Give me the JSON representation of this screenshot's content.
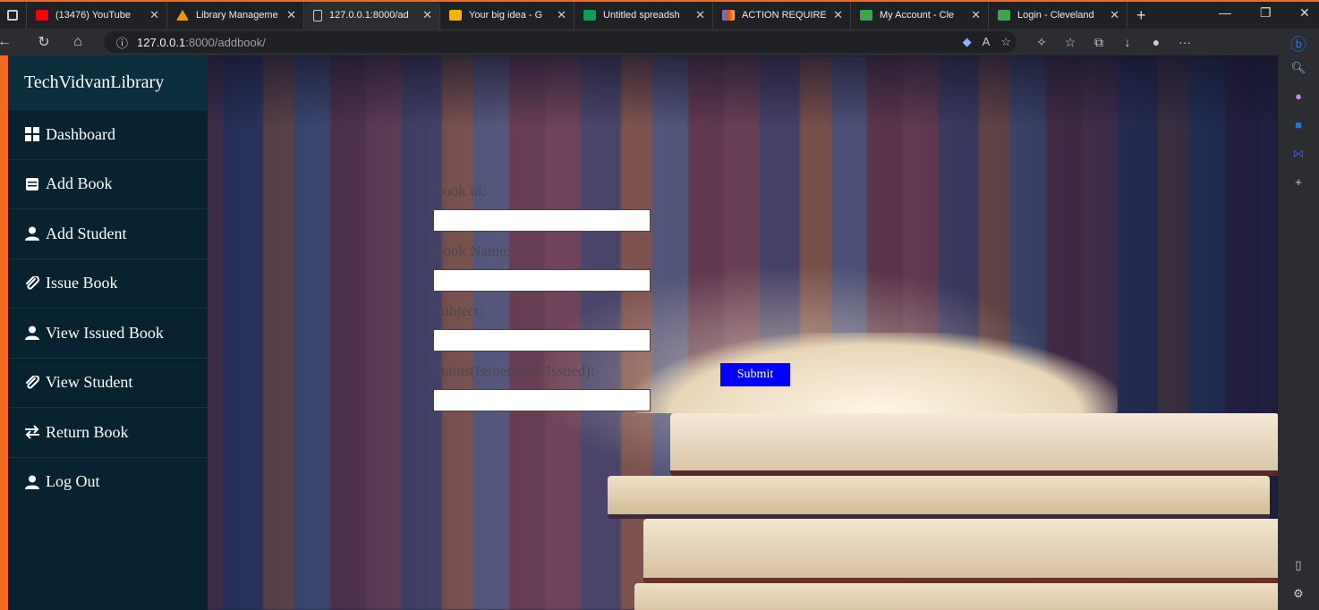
{
  "browser": {
    "tabs": [
      {
        "title": "(13476) YouTube",
        "color": "#ff0000"
      },
      {
        "title": "Library Manageme",
        "color": "#f29900"
      },
      {
        "title": "127.0.0.1:8000/ad",
        "color": "#cccccc",
        "active": true
      },
      {
        "title": "Your big idea - G",
        "color": "#f4b400"
      },
      {
        "title": "Untitled spreadsh",
        "color": "#0f9d58"
      },
      {
        "title": "ACTION REQUIRE",
        "color": "#ea4335"
      },
      {
        "title": "My Account - Cle",
        "color": "#3fa34d"
      },
      {
        "title": "Login - Cleveland",
        "color": "#3fa34d"
      }
    ],
    "url_host": "127.0.0.1",
    "url_path": ":8000/addbook/"
  },
  "sidebar": {
    "brand": "TechVidvanLibrary",
    "items": [
      {
        "label": "Dashboard",
        "icon": "grid-icon"
      },
      {
        "label": "Add Book",
        "icon": "book-icon"
      },
      {
        "label": "Add Student",
        "icon": "user-icon"
      },
      {
        "label": "Issue Book",
        "icon": "paperclip-icon"
      },
      {
        "label": "View Issued Book",
        "icon": "user-icon"
      },
      {
        "label": "View Student",
        "icon": "paperclip-icon"
      },
      {
        "label": "Return Book",
        "icon": "exchange-icon"
      },
      {
        "label": "Log Out",
        "icon": "user-icon"
      }
    ]
  },
  "form": {
    "book_id_label": "Book id:",
    "book_id_value": "",
    "book_name_label": "Book Name:",
    "book_name_value": "",
    "subject_label": "Subject:",
    "subject_value": "",
    "status_label": "Status(Issued/Not-Issued):",
    "status_value": "",
    "submit_label": "Submit"
  },
  "colors": {
    "sidebar_bg": "#08232f",
    "submit_bg": "#0000ff"
  }
}
